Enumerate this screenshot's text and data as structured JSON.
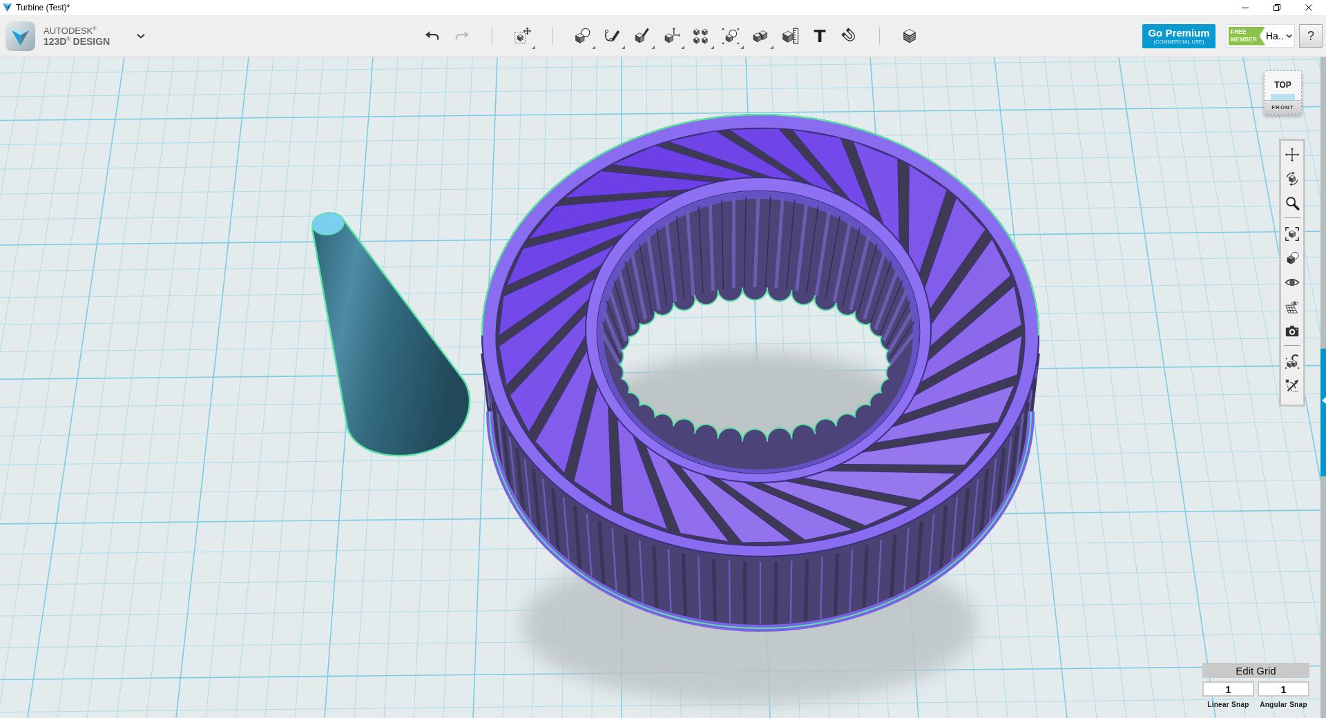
{
  "window": {
    "title": "Turbine (Test)*",
    "controls": [
      {
        "kind": "minimize"
      },
      {
        "kind": "restore"
      },
      {
        "kind": "close"
      }
    ]
  },
  "brand": {
    "company": "AUTODESK$^{®}$",
    "product": "123D$^{®}$ DESIGN"
  },
  "toolbar": {
    "history": [
      {
        "kind": "undo",
        "disabled": false
      },
      {
        "kind": "redo",
        "disabled": true
      }
    ],
    "groups": [
      {
        "tools": [
          {
            "kind": "transform",
            "has_menu": true
          }
        ]
      },
      {
        "tools": [
          {
            "kind": "primitives",
            "has_menu": true
          },
          {
            "kind": "sketch",
            "has_menu": true
          },
          {
            "kind": "construct",
            "has_menu": true
          },
          {
            "kind": "modify",
            "has_menu": true
          },
          {
            "kind": "pattern",
            "has_menu": true
          },
          {
            "kind": "grouping",
            "has_menu": true
          },
          {
            "kind": "combine",
            "has_menu": true
          },
          {
            "kind": "measure",
            "has_menu": false
          },
          {
            "kind": "text",
            "glyph": "T",
            "has_menu": false
          },
          {
            "kind": "snap",
            "has_menu": false
          }
        ]
      },
      {
        "tools": [
          {
            "kind": "materials",
            "has_menu": false
          }
        ]
      }
    ]
  },
  "premium": {
    "label": "Go Premium",
    "note": "(COMMERCIAL USE)"
  },
  "account": {
    "badge_top": "FREE",
    "badge_bottom": "MEMBER",
    "user": "Ha.."
  },
  "help": {
    "label": "?"
  },
  "view_cube": {
    "top": "TOP",
    "front": "FRONT"
  },
  "navigation": {
    "groups": [
      {
        "tools": [
          {
            "kind": "pan"
          },
          {
            "kind": "orbit"
          },
          {
            "kind": "zoom"
          }
        ]
      },
      {
        "tools": [
          {
            "kind": "fit"
          },
          {
            "kind": "views"
          },
          {
            "kind": "visibility"
          },
          {
            "kind": "grid"
          },
          {
            "kind": "camera"
          }
        ]
      },
      {
        "tools": [
          {
            "kind": "snap"
          },
          {
            "kind": "tape"
          }
        ]
      }
    ]
  },
  "scene": {
    "objects": [
      {
        "kind": "cone",
        "selected": true
      },
      {
        "kind": "turbine",
        "selected": true
      }
    ]
  },
  "edit_grid": {
    "title": "Edit Grid",
    "fields": [
      {
        "label": "Linear Snap",
        "value": "1"
      },
      {
        "label": "Angular Snap",
        "value": "1"
      }
    ]
  }
}
